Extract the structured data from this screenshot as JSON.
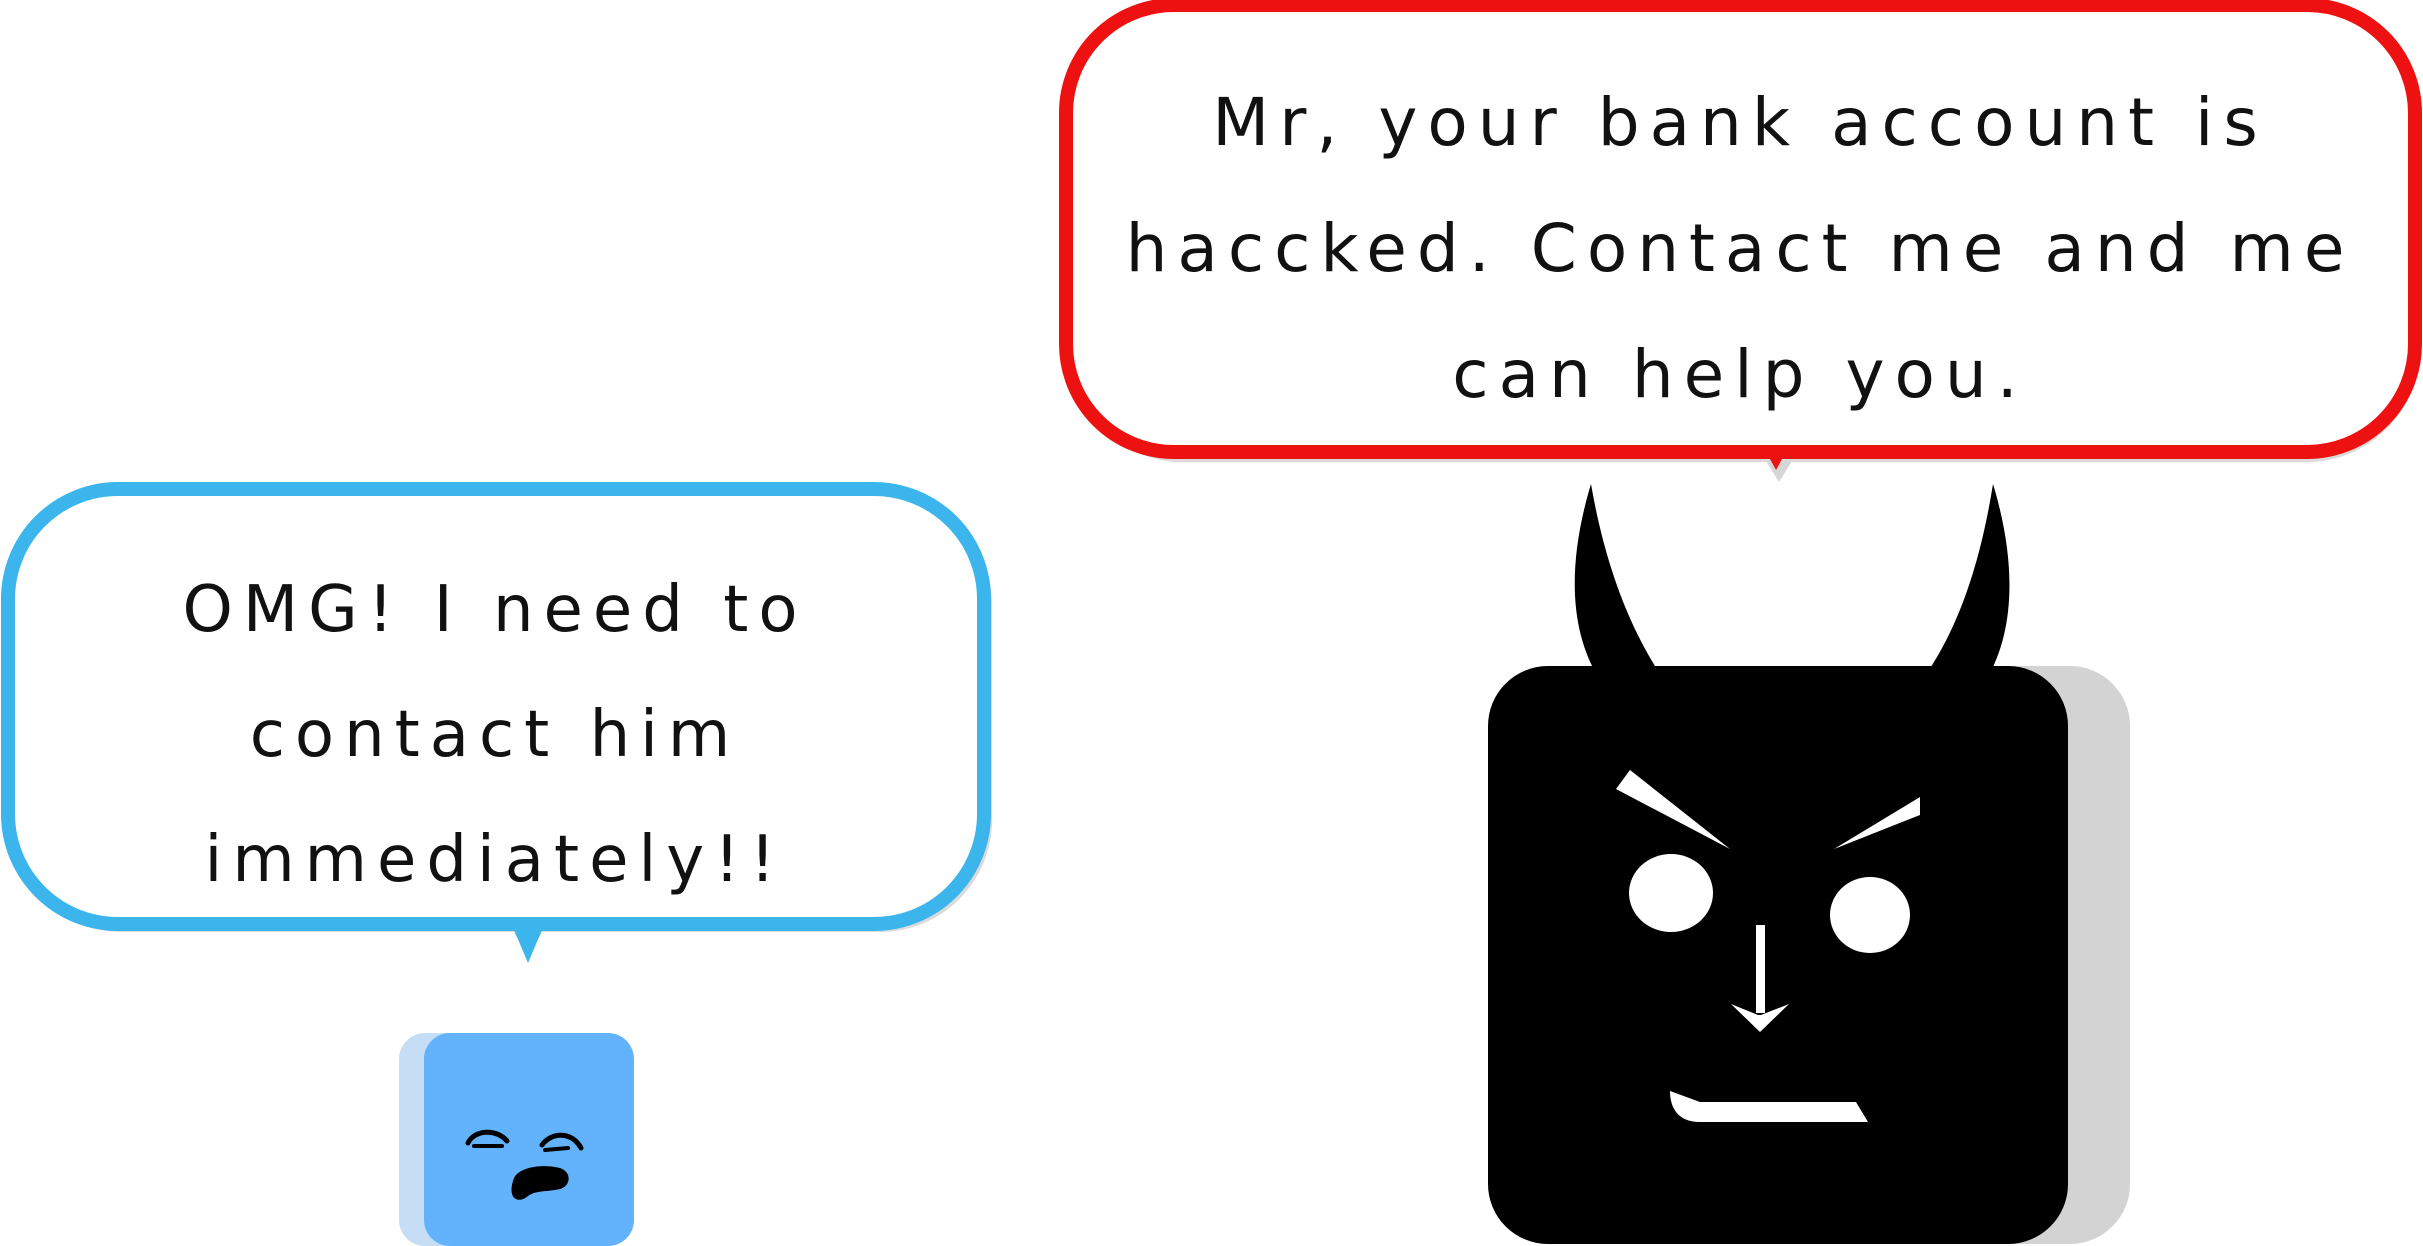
{
  "scene": {
    "scammer": {
      "speech": {
        "line1": "Mr, your bank account is",
        "line2": "haccked. Contact me and me",
        "line3": "can help you."
      },
      "bubble_color": "#ee1111",
      "body_color": "#000000",
      "shadow_color": "#d3d3d3"
    },
    "victim": {
      "speech": {
        "line1": "OMG! I need to",
        "line2": "contact him",
        "line3": "immediately!!"
      },
      "bubble_color": "#3bb5ec",
      "body_color": "#62b3fb",
      "shadow_color": "#c5ddf5"
    }
  }
}
